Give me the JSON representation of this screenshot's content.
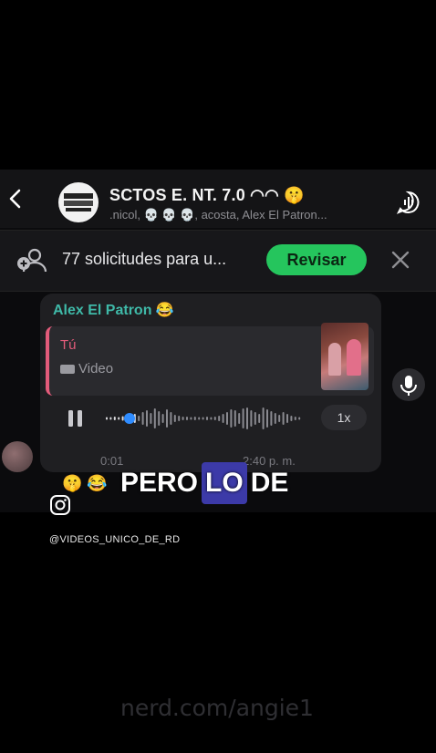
{
  "header": {
    "back_icon": "chevron-left-icon",
    "group_title": "SCTOS E. NT. 7.0",
    "group_title_emoji": "◠◠ 🤫",
    "group_members": ".nicol, 💀 💀 💀, acosta, Alex El Patron...",
    "call_icon": "voice-call-icon"
  },
  "banner": {
    "text": "77 solicitudes para u...",
    "review_button": "Revisar",
    "close_icon": "close-icon"
  },
  "message": {
    "sender": "Alex El Patron 😂",
    "quote_name": "Tú",
    "quote_type": "Video",
    "speed": "1x",
    "duration": "0:01",
    "time": "2:40 p. m."
  },
  "reactions": "🤫 😂",
  "caption": {
    "word1": "PERO",
    "word2": "LO",
    "word3": "DE"
  },
  "overlay": {
    "handle": "@VIDEOS_UNICO_DE_RD",
    "watermark": "nerd.com/angie1"
  },
  "colors": {
    "accent_green": "#25c55d",
    "sender_teal": "#3fb9a8",
    "quote_pink": "#e25b7a",
    "caption_highlight": "#3c3aa8"
  }
}
